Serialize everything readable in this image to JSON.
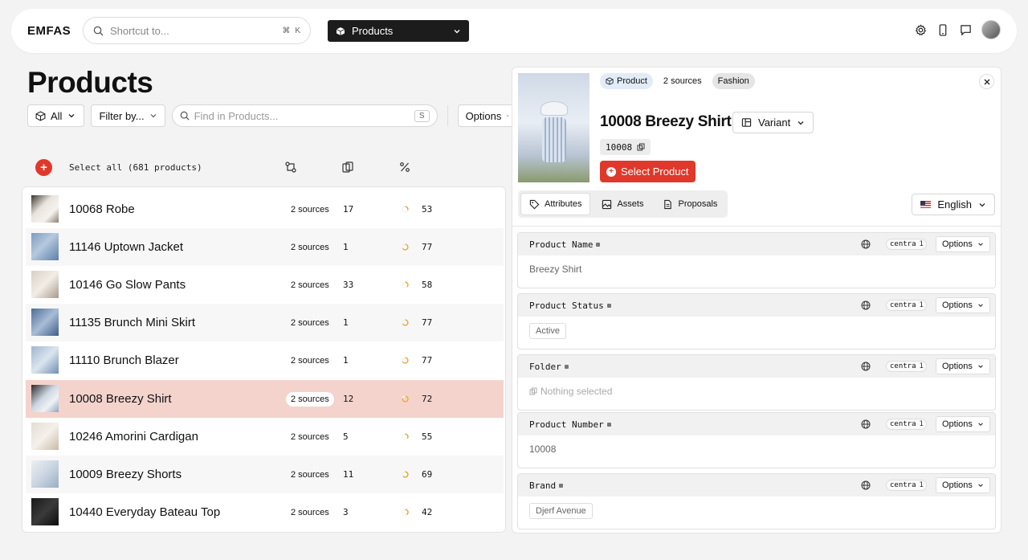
{
  "app": {
    "logo": "EMFAS",
    "search": {
      "placeholder": "Shortcut to...",
      "kbd_mod": "⌘",
      "kbd_key": "K"
    },
    "product_selector": "Products"
  },
  "page": {
    "title": "Products",
    "filters": {
      "all_label": "All",
      "filter_label": "Filter by...",
      "find_placeholder": "Find in Products...",
      "find_key": "S",
      "options_label": "Options"
    },
    "select_all": "Select all (681 products)",
    "products": [
      {
        "name": "10068 Robe",
        "sources": "2 sources",
        "count": "17",
        "pct": "53"
      },
      {
        "name": "11146 Uptown Jacket",
        "sources": "2 sources",
        "count": "1",
        "pct": "77"
      },
      {
        "name": "10146 Go Slow Pants",
        "sources": "2 sources",
        "count": "33",
        "pct": "58"
      },
      {
        "name": "11135 Brunch Mini Skirt",
        "sources": "2 sources",
        "count": "1",
        "pct": "77"
      },
      {
        "name": "11110 Brunch Blazer",
        "sources": "2 sources",
        "count": "1",
        "pct": "77"
      },
      {
        "name": "10008 Breezy Shirt",
        "sources": "2 sources",
        "count": "12",
        "pct": "72"
      },
      {
        "name": "10246 Amorini Cardigan",
        "sources": "2 sources",
        "count": "5",
        "pct": "55"
      },
      {
        "name": "10009 Breezy Shorts",
        "sources": "2 sources",
        "count": "11",
        "pct": "69"
      },
      {
        "name": "10440 Everyday Bateau Top",
        "sources": "2 sources",
        "count": "3",
        "pct": "42"
      }
    ]
  },
  "detail": {
    "chips": {
      "product": "Product",
      "sources": "2 sources",
      "fashion": "Fashion"
    },
    "title": "10008 Breezy Shirt",
    "variant_label": "Variant",
    "sku": "10008",
    "select_product": "Select Product",
    "tabs": {
      "attributes": "Attributes",
      "assets": "Assets",
      "proposals": "Proposals"
    },
    "language": "English",
    "attributes": [
      {
        "label": "Product Name",
        "source": "centra",
        "source_count": "1",
        "options": "Options",
        "value": "Breezy Shirt"
      },
      {
        "label": "Product Status",
        "source": "centra",
        "source_count": "1",
        "options": "Options",
        "value": "Active"
      },
      {
        "label": "Folder",
        "source": "centra",
        "source_count": "1",
        "options": "Options",
        "value": "Nothing selected"
      },
      {
        "label": "Product Number",
        "source": "centra",
        "source_count": "1",
        "options": "Options",
        "value": "10008"
      },
      {
        "label": "Brand",
        "source": "centra",
        "source_count": "1",
        "options": "Options",
        "value": "Djerf Avenue"
      }
    ]
  },
  "colors": {
    "accent": "#e0382a",
    "selected_row": "#f4d3cd",
    "progress": "#e6a020"
  }
}
